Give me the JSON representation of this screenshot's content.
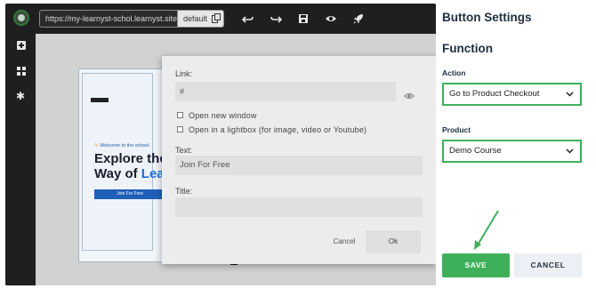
{
  "editor": {
    "url": "https://my-learnyst-schol.learnyst.site/",
    "device": "default"
  },
  "preview": {
    "welcome": "Welcome to the school",
    "headline_line1": "Explore the",
    "headline_line2a": "Way of ",
    "headline_line2b": "Lea",
    "cta": "Join For Free"
  },
  "dialog": {
    "link_label": "Link:",
    "link_value": "#",
    "new_window_label": "Open new window",
    "lightbox_label": "Open in a lightbox (for image, video or Youtube)",
    "text_label": "Text:",
    "text_value": "Join For Free",
    "title_label": "Title:",
    "title_value": "",
    "cancel_label": "Cancel",
    "ok_label": "Ok"
  },
  "panel": {
    "title": "Button Settings",
    "section": "Function",
    "action_label": "Action",
    "action_value": "Go to Product Checkout",
    "product_label": "Product",
    "product_value": "Demo Course",
    "save_label": "SAVE",
    "cancel_label": "CANCEL"
  },
  "colors": {
    "accent": "#3fb05a",
    "editor_bg": "#1f1f20",
    "link_blue": "#1f6fe0"
  },
  "icons": [
    "logo-icon",
    "add-icon",
    "grid-icon",
    "gear-icon",
    "copy-icon",
    "undo-icon",
    "redo-icon",
    "save-icon",
    "eye-icon",
    "rocket-icon",
    "chevron-down-icon"
  ]
}
